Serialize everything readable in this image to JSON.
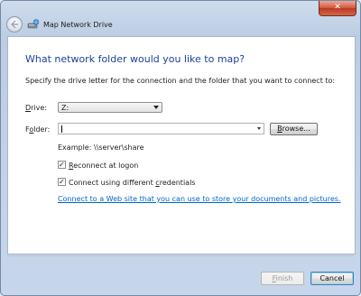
{
  "window": {
    "title": "Map Network Drive",
    "close_glyph": "✕"
  },
  "wizard": {
    "heading": "What network folder would you like to map?",
    "instruction": "Specify the drive letter for the connection and the folder that you want to connect to:",
    "drive": {
      "label_pre": "",
      "label_mnemonic": "D",
      "label_post": "rive:",
      "value": "Z:"
    },
    "folder": {
      "label_pre": "F",
      "label_mnemonic": "o",
      "label_post": "lder:",
      "value": ""
    },
    "browse": {
      "label_pre": "",
      "label_mnemonic": "B",
      "label_post": "rowse..."
    },
    "example": "Example: \\\\server\\share",
    "reconnect": {
      "checked": true,
      "label_pre": "",
      "label_mnemonic": "R",
      "label_post": "econnect at logon"
    },
    "credentials": {
      "checked": true,
      "label_pre": "Connect using different ",
      "label_mnemonic": "c",
      "label_post": "redentials"
    },
    "link": "Connect to a Web site that you can use to store your documents and pictures."
  },
  "buttons": {
    "finish_pre": "",
    "finish_mnemonic": "F",
    "finish_post": "inish",
    "cancel": "Cancel"
  },
  "icons": {
    "back": "back-arrow-icon",
    "app": "network-drive-icon",
    "close": "close-icon",
    "dropdown": "chevron-down-icon"
  }
}
